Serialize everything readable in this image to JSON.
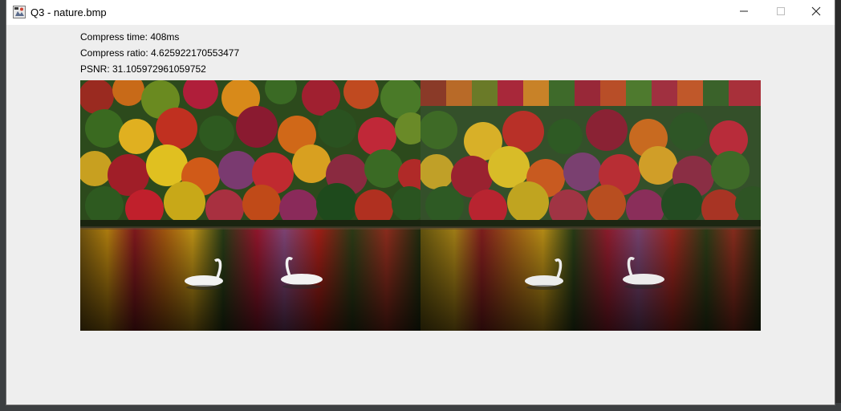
{
  "window": {
    "title": "Q3 - nature.bmp",
    "icon": "java-app-icon",
    "controls": {
      "minimize": "minimize-icon",
      "maximize": "maximize-icon",
      "close": "close-icon"
    }
  },
  "stats": {
    "compress_time": "Compress time: 408ms",
    "compress_ratio": "Compress ratio: 4.625922170553477",
    "psnr": "PSNR: 31.105972961059752"
  },
  "images": {
    "original": "original-autumn-lake-swans-image",
    "compressed": "compressed-autumn-lake-swans-image"
  },
  "colors": {
    "title_bar": "#ffffff",
    "window_bg": "#eeeeee",
    "text": "#000000"
  }
}
